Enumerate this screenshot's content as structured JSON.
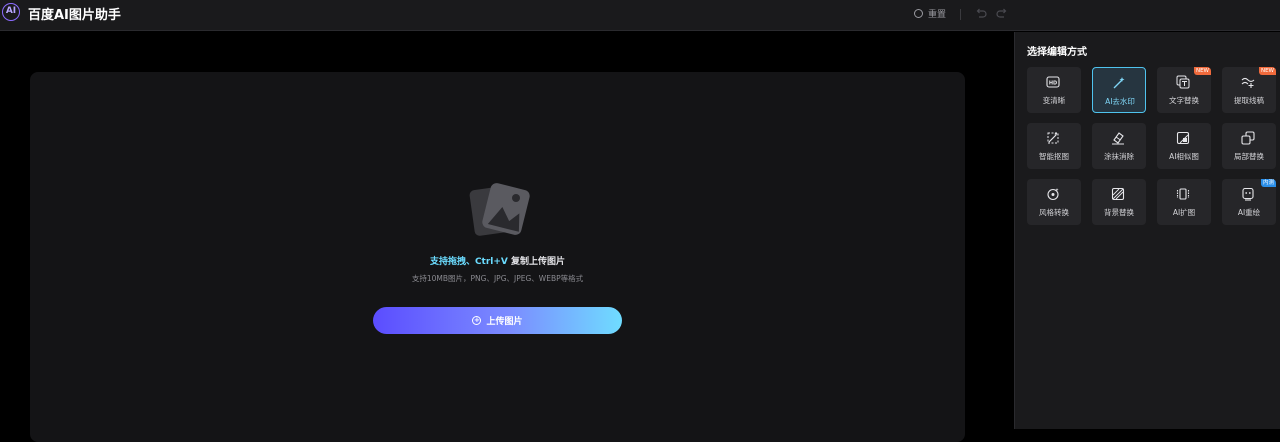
{
  "header": {
    "logo_text": "AI",
    "app_title": "百度AI图片助手",
    "reset_label": "重置",
    "undo_icon": "undo-icon",
    "redo_icon": "redo-icon"
  },
  "upload": {
    "hint_accent": "支持拖拽、Ctrl+V",
    "hint_rest": " 复制上传图片",
    "formats": "支持10MB图片，PNG、JPG、JPEG、WEBP等格式",
    "button_label": "上传图片"
  },
  "sidebar": {
    "title": "选择编辑方式",
    "tools": [
      {
        "label": "变清晰",
        "icon": "hd-icon",
        "badge": "",
        "active": false
      },
      {
        "label": "AI去水印",
        "icon": "magic-wand-icon",
        "badge": "",
        "active": true
      },
      {
        "label": "文字替换",
        "icon": "text-replace-icon",
        "badge": "NEW",
        "active": false
      },
      {
        "label": "提取线稿",
        "icon": "line-art-icon",
        "badge": "NEW",
        "active": false
      },
      {
        "label": "智能抠图",
        "icon": "cutout-icon",
        "badge": "",
        "active": false
      },
      {
        "label": "涂抹消除",
        "icon": "eraser-icon",
        "badge": "",
        "active": false
      },
      {
        "label": "AI相似图",
        "icon": "similar-image-icon",
        "badge": "",
        "active": false
      },
      {
        "label": "局部替换",
        "icon": "partial-replace-icon",
        "badge": "",
        "active": false
      },
      {
        "label": "风格转换",
        "icon": "style-transfer-icon",
        "badge": "",
        "active": false
      },
      {
        "label": "背景替换",
        "icon": "background-replace-icon",
        "badge": "",
        "active": false
      },
      {
        "label": "AI扩图",
        "icon": "expand-icon",
        "badge": "",
        "active": false
      },
      {
        "label": "AI重绘",
        "icon": "redraw-icon",
        "badge": "内测",
        "active": false
      }
    ]
  },
  "colors": {
    "accent": "#6bdcff",
    "active_border": "#4fc3ee",
    "badge_new": "#f06a3c",
    "badge_beta": "#2a8ee8",
    "button_gradient_start": "#5b4dff",
    "button_gradient_end": "#6fdcff"
  }
}
